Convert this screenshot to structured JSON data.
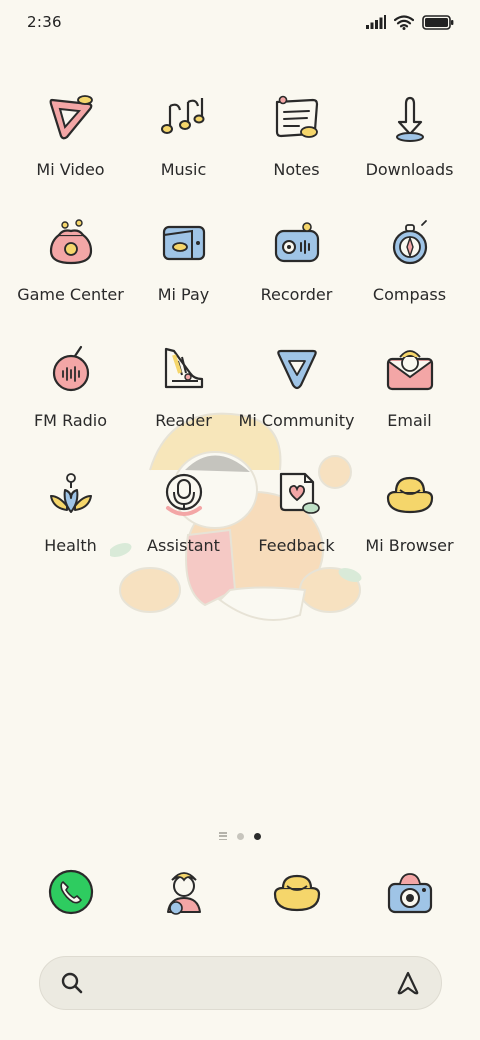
{
  "status_bar": {
    "time": "2:36",
    "icons": [
      "signal-icon",
      "wifi-icon",
      "battery-icon"
    ]
  },
  "apps": [
    {
      "label": "Mi Video",
      "icon": "mi-video-icon"
    },
    {
      "label": "Music",
      "icon": "music-icon"
    },
    {
      "label": "Notes",
      "icon": "notes-icon"
    },
    {
      "label": "Downloads",
      "icon": "downloads-icon"
    },
    {
      "label": "Game Center",
      "icon": "game-center-icon"
    },
    {
      "label": "Mi Pay",
      "icon": "mi-pay-icon"
    },
    {
      "label": "Recorder",
      "icon": "recorder-icon"
    },
    {
      "label": "Compass",
      "icon": "compass-icon"
    },
    {
      "label": "FM Radio",
      "icon": "fm-radio-icon"
    },
    {
      "label": "Reader",
      "icon": "reader-icon"
    },
    {
      "label": "Mi Community",
      "icon": "mi-community-icon"
    },
    {
      "label": "Email",
      "icon": "email-icon"
    },
    {
      "label": "Health",
      "icon": "health-icon"
    },
    {
      "label": "Assistant",
      "icon": "assistant-icon"
    },
    {
      "label": "Feedback",
      "icon": "feedback-icon"
    },
    {
      "label": "Mi Browser",
      "icon": "mi-browser-icon"
    }
  ],
  "page_indicator": {
    "pages": 2,
    "active": 2
  },
  "dock": [
    {
      "icon": "phone-icon"
    },
    {
      "icon": "contacts-icon"
    },
    {
      "icon": "gold-ingot-icon"
    },
    {
      "icon": "camera-icon"
    }
  ],
  "search_bar": {
    "icons": [
      "search-icon",
      "assistant-logo-icon"
    ]
  },
  "colors": {
    "background": "#faf8f0",
    "pink": "#f3a6a6",
    "yellow": "#f5d66b",
    "blue": "#9fc4e6",
    "green": "#2ecc60",
    "outline": "#2a2a2a"
  }
}
